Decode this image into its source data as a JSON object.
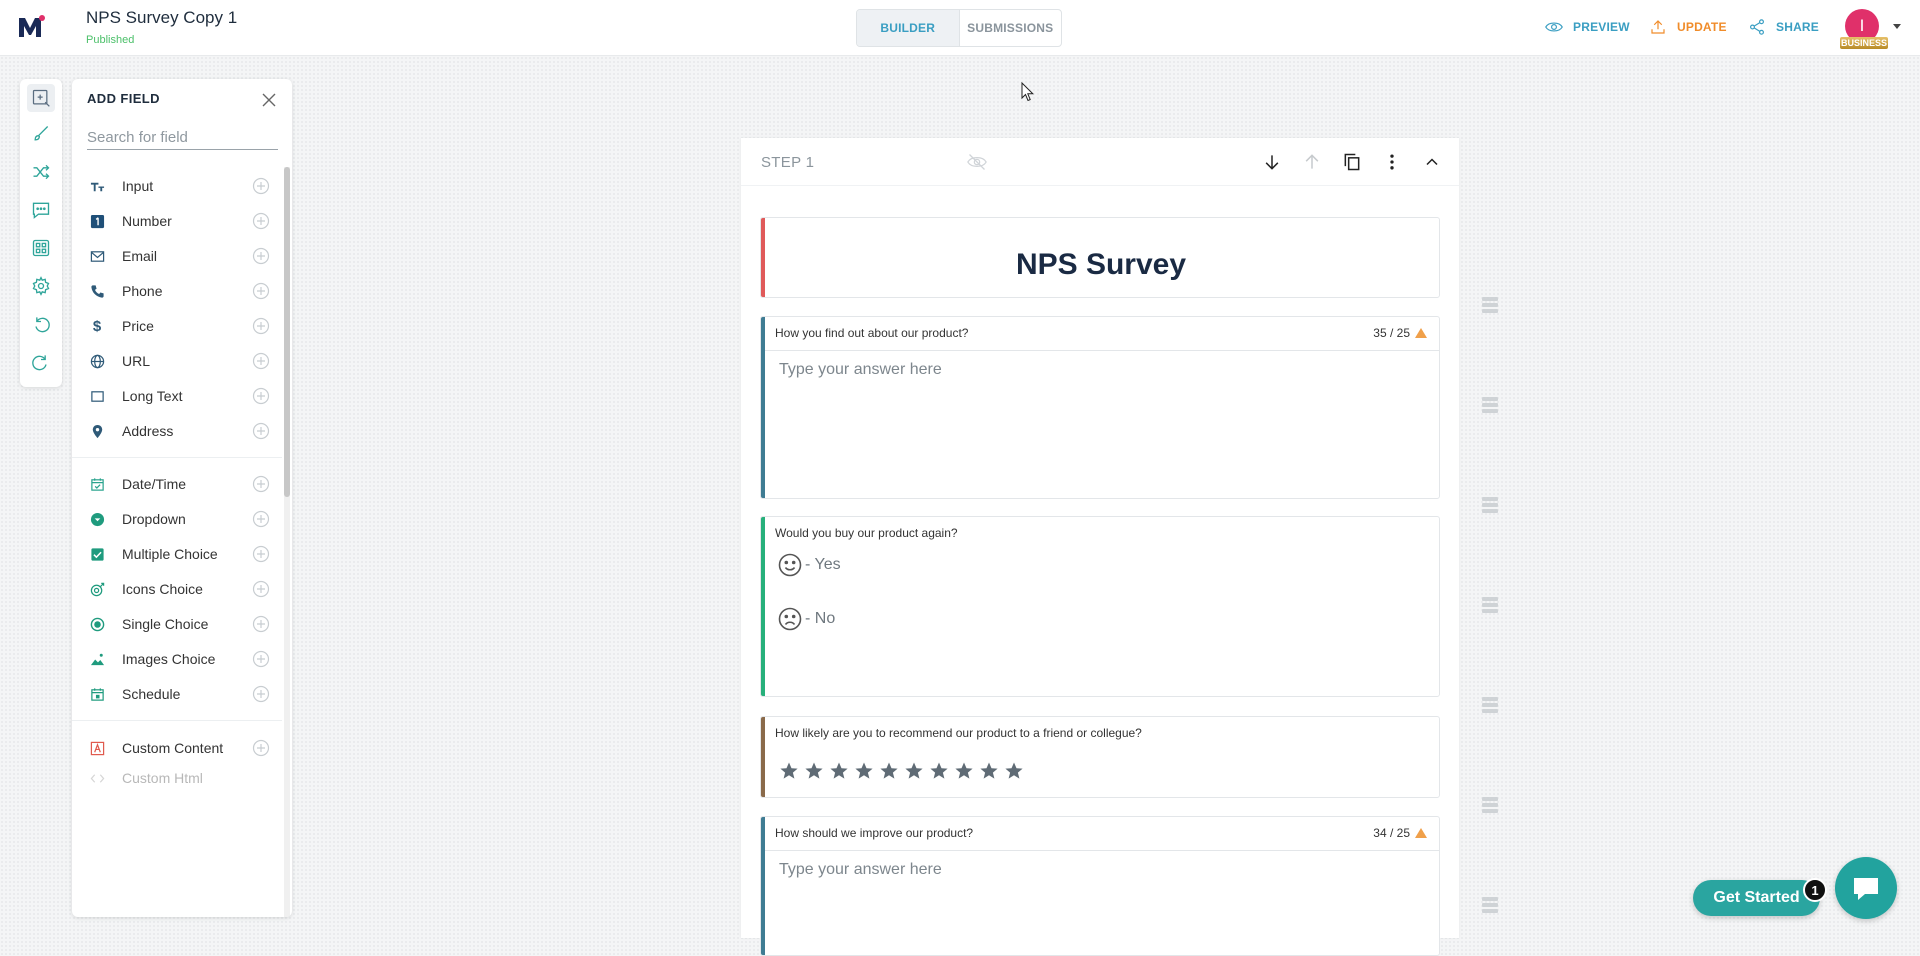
{
  "header": {
    "title": "NPS Survey Copy 1",
    "status": "Published",
    "tabs": [
      {
        "label": "BUILDER",
        "active": true
      },
      {
        "label": "SUBMISSIONS",
        "active": false
      }
    ],
    "actions": [
      {
        "label": "PREVIEW",
        "icon": "eye-icon",
        "color": "#3a9ec2"
      },
      {
        "label": "UPDATE",
        "icon": "upload-icon",
        "color": "#f08c2a"
      },
      {
        "label": "SHARE",
        "icon": "share-icon",
        "color": "#3a9ec2"
      }
    ],
    "avatar_initial": "I",
    "plan_badge": "BUSINESS"
  },
  "rail": {
    "items": [
      "add-field-icon",
      "brush-icon",
      "shuffle-icon",
      "message-icon",
      "grid-icon",
      "settings-icon",
      "undo-icon",
      "redo-icon"
    ]
  },
  "panel": {
    "title": "ADD FIELD",
    "search_placeholder": "Search for field",
    "groups": [
      [
        {
          "label": "Input",
          "icon": "text-icon"
        },
        {
          "label": "Number",
          "icon": "number-icon"
        },
        {
          "label": "Email",
          "icon": "mail-icon"
        },
        {
          "label": "Phone",
          "icon": "phone-icon"
        },
        {
          "label": "Price",
          "icon": "dollar-icon"
        },
        {
          "label": "URL",
          "icon": "globe-icon"
        },
        {
          "label": "Long Text",
          "icon": "textarea-icon"
        },
        {
          "label": "Address",
          "icon": "location-pin-icon"
        }
      ],
      [
        {
          "label": "Date/Time",
          "icon": "calendar-icon"
        },
        {
          "label": "Dropdown",
          "icon": "dropdown-icon"
        },
        {
          "label": "Multiple Choice",
          "icon": "checkbox-icon"
        },
        {
          "label": "Icons Choice",
          "icon": "icons-choice-icon"
        },
        {
          "label": "Single Choice",
          "icon": "radio-icon"
        },
        {
          "label": "Images Choice",
          "icon": "image-icon"
        },
        {
          "label": "Schedule",
          "icon": "schedule-icon"
        }
      ],
      [
        {
          "label": "Custom Content",
          "icon": "custom-content-icon"
        },
        {
          "label": "Custom Html",
          "icon": "code-icon"
        }
      ]
    ]
  },
  "step": {
    "label": "STEP 1",
    "tools": [
      "arrow-down-icon",
      "arrow-up-icon",
      "copy-icon",
      "more-vertical-icon",
      "chevron-up-icon"
    ]
  },
  "form": {
    "title": "NPS Survey",
    "questions": [
      {
        "type": "long_text",
        "label": "How you find out about our product?",
        "counter": "35 / 25",
        "placeholder": "Type your answer here",
        "accent": "#3f7c93"
      },
      {
        "type": "icons_choice",
        "label": "Would you buy our product again?",
        "options": [
          {
            "label": "- Yes",
            "icon": "smile-icon"
          },
          {
            "label": "- No",
            "icon": "frown-icon"
          }
        ],
        "accent": "#27b07b"
      },
      {
        "type": "rating",
        "label": "How likely are you to recommend our product to a friend or collegue?",
        "stars": 10,
        "accent": "#8a6a4a"
      },
      {
        "type": "long_text",
        "label": "How should we improve our product?",
        "counter": "34 / 25",
        "placeholder": "Type your answer here",
        "accent": "#3f7c93"
      }
    ]
  },
  "chat_widget": {
    "button_label": "Get Started",
    "notification_count": "1"
  }
}
